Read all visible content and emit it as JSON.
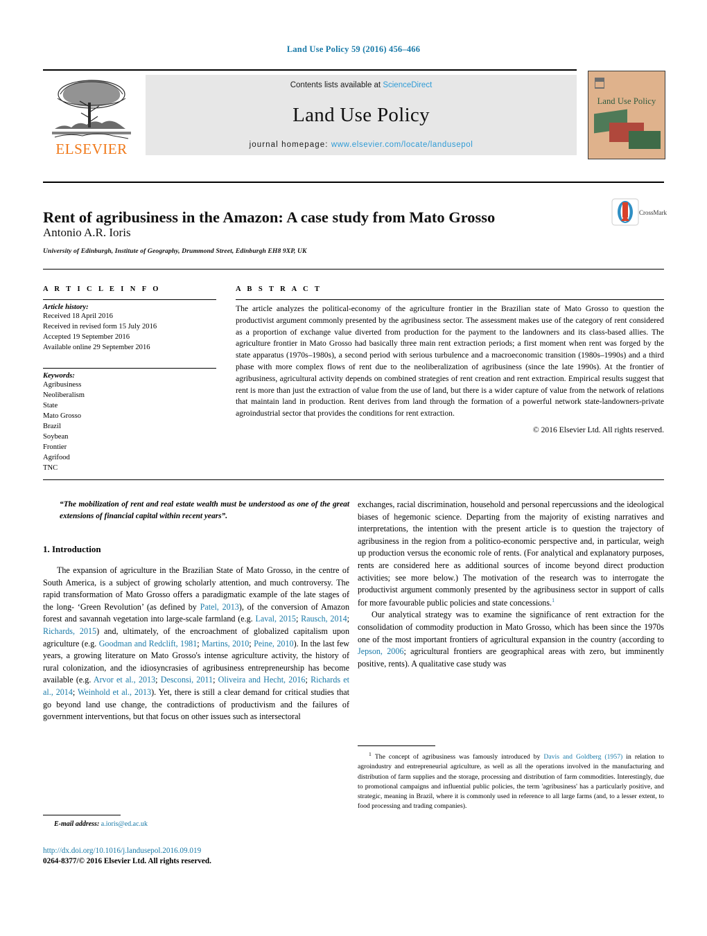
{
  "running_head": "Land Use Policy 59 (2016) 456–466",
  "masthead": {
    "contents_prefix": "Contents lists available at ",
    "sciencedirect": "ScienceDirect",
    "journal_title": "Land Use Policy",
    "homepage_prefix": "journal homepage: ",
    "homepage_url": "www.elsevier.com/locate/landusepol",
    "publisher_word": "ELSEVIER",
    "cover_label": "Land Use Policy",
    "accent_link": "#2e9bd6",
    "publisher_orange": "#f07818",
    "cover_bg": "#dfb28c"
  },
  "title_block": {
    "title": "Rent of agribusiness in the Amazon: A case study from Mato Grosso",
    "authors": "Antonio A.R. Ioris",
    "affiliation": "University of Edinburgh, Institute of Geography, Drummond Street, Edinburgh EH8 9XP, UK",
    "crossmark_label": "CrossMark"
  },
  "article_info": {
    "heading": "A R T I C L E   I N F O",
    "history_label": "Article history:",
    "history": [
      "Received 18 April 2016",
      "Received in revised form 15 July 2016",
      "Accepted 19 September 2016",
      "Available online 29 September 2016"
    ],
    "keywords_label": "Keywords:",
    "keywords": [
      "Agribusiness",
      "Neoliberalism",
      "State",
      "Mato Grosso",
      "Brazil",
      "Soybean",
      "Frontier",
      "Agrifood",
      "TNC"
    ]
  },
  "abstract": {
    "heading": "A B S T R A C T",
    "text": "The article analyzes the political-economy of the agriculture frontier in the Brazilian state of Mato Grosso to question the productivist argument commonly presented by the agribusiness sector. The assessment makes use of the category of rent considered as a proportion of exchange value diverted from production for the payment to the landowners and its class-based allies. The agriculture frontier in Mato Grosso had basically three main rent extraction periods; a first moment when rent was forged by the state apparatus (1970s–1980s), a second period with serious turbulence and a macroeconomic transition (1980s–1990s) and a third phase with more complex flows of rent due to the neoliberalization of agribusiness (since the late 1990s). At the frontier of agribusiness, agricultural activity depends on combined strategies of rent creation and rent extraction. Empirical results suggest that rent is more than just the extraction of value from the use of land, but there is a wider capture of value from the network of relations that maintain land in production. Rent derives from land through the formation of a powerful network state-landowners-private agroindustrial sector that provides the conditions for rent extraction.",
    "copyright": "© 2016 Elsevier Ltd. All rights reserved."
  },
  "body": {
    "epigraph": "“The mobilization of rent and real estate wealth must be understood as one of the great extensions of financial capital within recent years”.",
    "section_heading": "1.  Introduction",
    "left_paragraphs": [
      "The expansion of agriculture in the Brazilian State of Mato Grosso, in the centre of South America, is a subject of growing scholarly attention, and much controversy. The rapid transformation of Mato Grosso offers a paradigmatic example of the late stages of the long- ‘Green Revolution’ (as defined by Patel, 2013), of the conversion of Amazon forest and savannah vegetation into large-scale farmland (e.g. Laval, 2015; Rausch, 2014; Richards, 2015) and, ultimately, of the encroachment of globalized capitalism upon agriculture (e.g. Goodman and Redclift, 1981; Martins, 2010; Peine, 2010). In the last few years, a growing literature on Mato Grosso's intense agriculture activity, the history of rural colonization, and the idiosyncrasies of agribusiness entrepreneurship has become available (e.g. Arvor et al., 2013; Desconsi, 2011; Oliveira and Hecht, 2016; Richards et al., 2014; Weinhold et al., 2013). Yet, there is still a clear demand for critical studies that go beyond land use change, the contradictions of productivism and the failures of government interventions, but that focus on other issues such as intersectoral"
    ],
    "right_paragraphs": [
      "exchanges, racial discrimination, household and personal repercussions and the ideological biases of hegemonic science. Departing from the majority of existing narratives and interpretations, the intention with the present article is to question the trajectory of agribusiness in the region from a politico-economic perspective and, in particular, weigh up production versus the economic role of rents. (For analytical and explanatory purposes, rents are considered here as additional sources of income beyond direct production activities; see more below.) The motivation of the research was to interrogate the productivist argument commonly presented by the agribusiness sector in support of calls for more favourable public policies and state concessions.",
      "Our analytical strategy was to examine the significance of rent extraction for the consolidation of commodity production in Mato Grosso, which has been since the 1970s one of the most important frontiers of agricultural expansion in the country (according to Jepson, 2006; agricultural frontiers are geographical areas with zero, but imminently positive, rents). A qualitative case study was"
    ],
    "footnote_marker": "1",
    "footnote": "The concept of agribusiness was famously introduced by Davis and Goldberg (1957) in relation to agroindustry and entrepreneurial agriculture, as well as all the operations involved in the manufacturing and distribution of farm supplies and the storage, processing and distribution of farm commodities. Interestingly, due to promotional campaigns and influential public policies, the term 'agribusiness' has a particularly positive, and strategic, meaning in Brazil, where it is commonly used in reference to all large farms (and, to a lesser extent, to food processing and trading companies)."
  },
  "footer": {
    "email_label": "E-mail address:",
    "email_address": "a.ioris@ed.ac.uk",
    "doi": "http://dx.doi.org/10.1016/j.landusepol.2016.09.019",
    "issn_line": "0264-8377/© 2016 Elsevier Ltd. All rights reserved.",
    "link_color": "#1a7aa8"
  }
}
